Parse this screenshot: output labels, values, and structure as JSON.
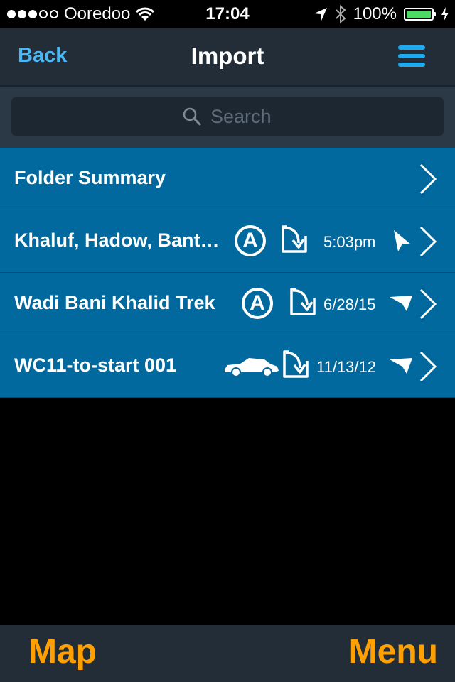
{
  "status_bar": {
    "carrier": "Ooredoo",
    "signal_bars_filled": 3,
    "signal_bars_total": 5,
    "time": "17:04",
    "battery_percent": "100%",
    "battery_level": 1.0
  },
  "nav": {
    "back_label": "Back",
    "title": "Import",
    "menu_icon": "hamburger-menu-icon"
  },
  "search": {
    "placeholder": "Search"
  },
  "rows": [
    {
      "title": "Folder Summary"
    },
    {
      "title": "Khaluf, Hadow, Bant…",
      "badge": "A",
      "date": "5:03pm"
    },
    {
      "title": "Wadi Bani Khalid Trek",
      "badge": "A",
      "date": "6/28/15"
    },
    {
      "title": "WC11-to-start 001",
      "date": "11/13/12"
    }
  ],
  "tabs": {
    "map": "Map",
    "menu": "Menu"
  },
  "colors": {
    "row_background": "#01699d",
    "accent_blue": "#1fa9ef",
    "tab_orange": "#ff9f00",
    "bar_background": "#222d38"
  }
}
